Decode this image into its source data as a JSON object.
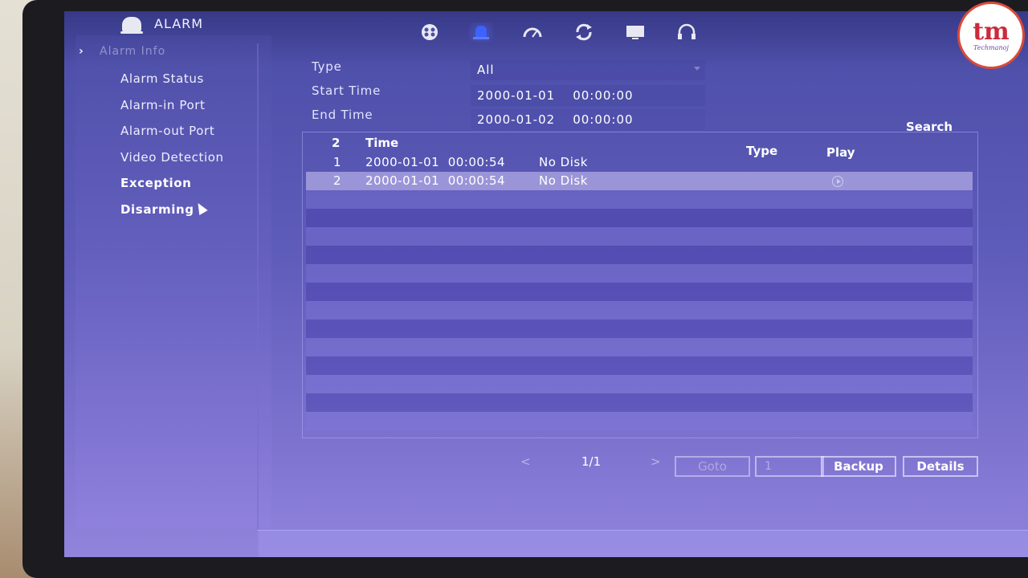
{
  "window": {
    "title": "ALARM"
  },
  "sidebar": {
    "header": "Alarm Info",
    "items": [
      {
        "label": "Alarm Status"
      },
      {
        "label": "Alarm-in Port"
      },
      {
        "label": "Alarm-out Port"
      },
      {
        "label": "Video Detection"
      },
      {
        "label": "Exception"
      },
      {
        "label": "Disarming"
      }
    ]
  },
  "toolbar": {
    "icons": [
      "film-reel-icon",
      "alarm-light-icon",
      "gauge-icon",
      "refresh-icon",
      "monitor-icon",
      "headset-icon"
    ],
    "active_icon": "alarm-light-icon"
  },
  "form": {
    "type_label": "Type",
    "type_value": "All",
    "start_label": "Start Time",
    "start_date": "2000-01-01",
    "start_time": "00:00:00",
    "end_label": "End Time",
    "end_date": "2000-01-02",
    "end_time": "00:00:00",
    "search_label": "Search"
  },
  "table": {
    "count": "2",
    "headers": {
      "time": "Time",
      "type": "Type",
      "play": "Play"
    },
    "rows": [
      {
        "index": "1",
        "time": "2000-01-01  00:00:54",
        "event": "No Disk"
      },
      {
        "index": "2",
        "time": "2000-01-01  00:00:54",
        "event": "No Disk"
      }
    ],
    "selected_row": 2
  },
  "pagination": {
    "prev": "<",
    "page": "1/1",
    "next": ">",
    "goto_label": "Goto",
    "goto_value": "1",
    "backup_label": "Backup",
    "details_label": "Details"
  },
  "logo": {
    "mark": "tm",
    "sub": "Techmanoj"
  },
  "colors": {
    "screen_top": "#4a4da6",
    "screen_bottom": "#9084dc",
    "logo_red": "#cc2a3a"
  }
}
